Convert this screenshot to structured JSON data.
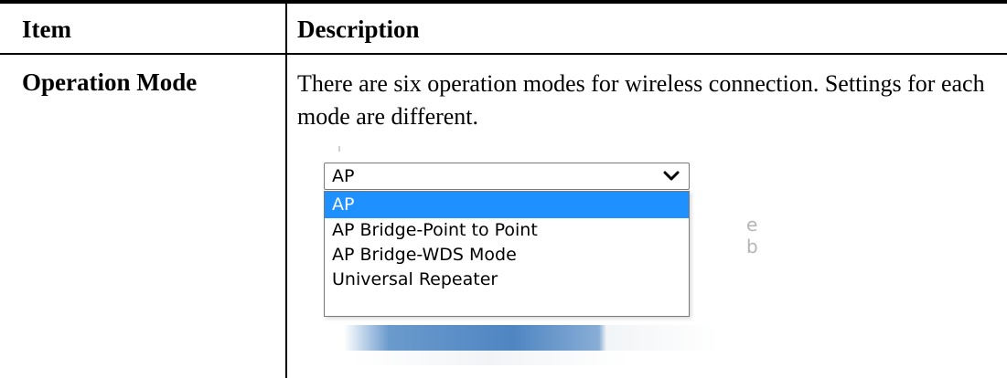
{
  "table": {
    "headers": {
      "item": "Item",
      "description": "Description"
    },
    "rows": [
      {
        "item": "Operation Mode",
        "description": "There are six operation modes for wireless connection. Settings for each mode are different."
      }
    ]
  },
  "dropdown": {
    "selected_value": "AP",
    "options": [
      "AP",
      "AP Bridge-Point to Point",
      "AP Bridge-WDS Mode",
      "Universal Repeater"
    ],
    "highlighted_option": "AP",
    "highlight_color": "#1e90ff"
  },
  "background_ghost_text": [
    "e",
    "b"
  ]
}
